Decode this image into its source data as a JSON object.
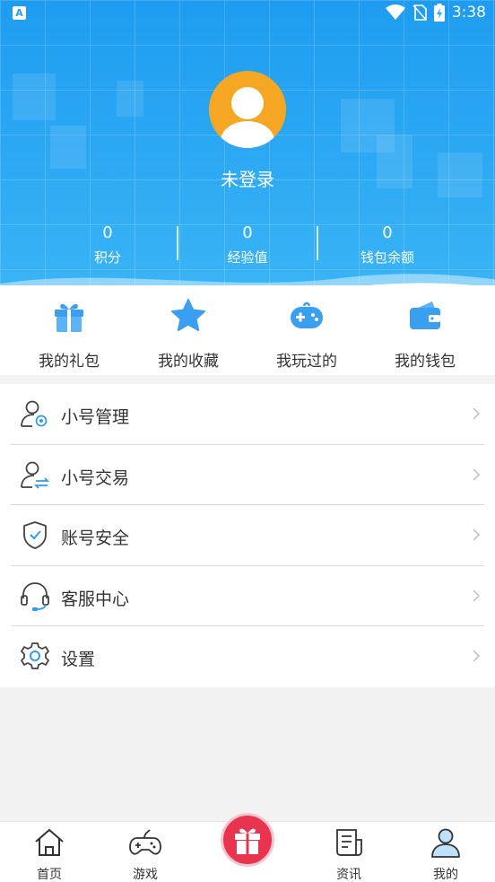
{
  "status_bar": {
    "time": "3:38",
    "app_badge": "A"
  },
  "profile": {
    "login_text": "未登录"
  },
  "stats": [
    {
      "value": "0",
      "label": "积分"
    },
    {
      "value": "0",
      "label": "经验值"
    },
    {
      "value": "0",
      "label": "钱包余额"
    }
  ],
  "quick_actions": [
    {
      "label": "我的礼包",
      "icon": "gift-icon"
    },
    {
      "label": "我的收藏",
      "icon": "star-icon"
    },
    {
      "label": "我玩过的",
      "icon": "gamepad-icon"
    },
    {
      "label": "我的钱包",
      "icon": "wallet-icon"
    }
  ],
  "menu": [
    {
      "label": "小号管理",
      "icon": "user-settings-icon"
    },
    {
      "label": "小号交易",
      "icon": "user-exchange-icon"
    },
    {
      "label": "账号安全",
      "icon": "shield-check-icon"
    },
    {
      "label": "客服中心",
      "icon": "headset-icon"
    },
    {
      "label": "设置",
      "icon": "gear-icon"
    }
  ],
  "bottom_nav": [
    {
      "label": "首页",
      "icon": "home-icon"
    },
    {
      "label": "游戏",
      "icon": "gamepad-outline-icon"
    },
    {
      "label": "资讯",
      "icon": "news-icon"
    },
    {
      "label": "我的",
      "icon": "profile-icon"
    }
  ],
  "colors": {
    "header_blue": "#2aa7f3",
    "accent_blue": "#2d9df0",
    "gift_red": "#e8344e",
    "avatar_orange": "#f5a623"
  }
}
